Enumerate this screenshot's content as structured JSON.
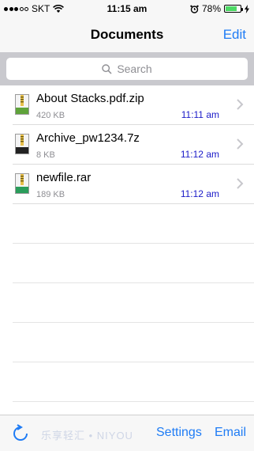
{
  "status_bar": {
    "carrier": "SKT",
    "time": "11:15 am",
    "battery_percent": "78%",
    "battery_level": 0.78,
    "icons": [
      "signal-dots-icon",
      "wifi-icon",
      "alarm-icon",
      "battery-icon",
      "charging-icon"
    ]
  },
  "nav": {
    "title": "Documents",
    "edit_label": "Edit"
  },
  "search": {
    "placeholder": "Search"
  },
  "files": [
    {
      "name": "About Stacks.pdf.zip",
      "size": "420 KB",
      "time": "11:11 am",
      "icon_badge": "zip"
    },
    {
      "name": "Archive_pw1234.7z",
      "size": "8 KB",
      "time": "11:12 am",
      "icon_badge": "7z"
    },
    {
      "name": "newfile.rar",
      "size": "189 KB",
      "time": "11:12 am",
      "icon_badge": "rar"
    }
  ],
  "toolbar": {
    "settings_label": "Settings",
    "email_label": "Email",
    "watermark": "乐享轻汇 • NIYOU"
  },
  "colors": {
    "accent": "#1f7cf5",
    "time_text": "#1a1ac8",
    "battery": "#4cd964"
  }
}
